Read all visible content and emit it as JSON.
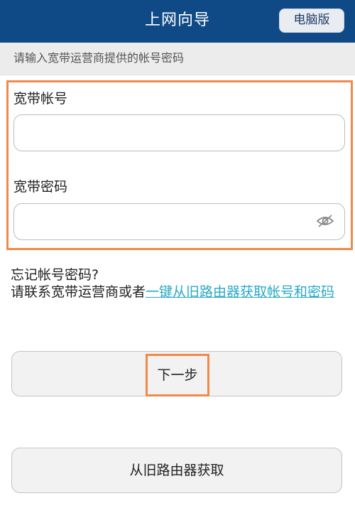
{
  "header": {
    "title": "上网向导",
    "pc_button_label": "电脑版"
  },
  "notice": "请输入宽带运营商提供的帐号密码",
  "form": {
    "account_label": "宽带帐号",
    "account_value": "",
    "password_label": "宽带密码",
    "password_value": "",
    "password_toggle_icon": "eye-hidden-icon"
  },
  "forgot": {
    "title": "忘记帐号密码?",
    "text": "请联系宽带运营商或者",
    "link_text": "一键从旧路由器获取帐号和密码"
  },
  "buttons": {
    "next_label": "下一步",
    "old_router_label": "从旧路由器获取"
  },
  "colors": {
    "header_bg": "#0f4a86",
    "highlight": "#f08a4b",
    "link": "#27a9c6"
  }
}
